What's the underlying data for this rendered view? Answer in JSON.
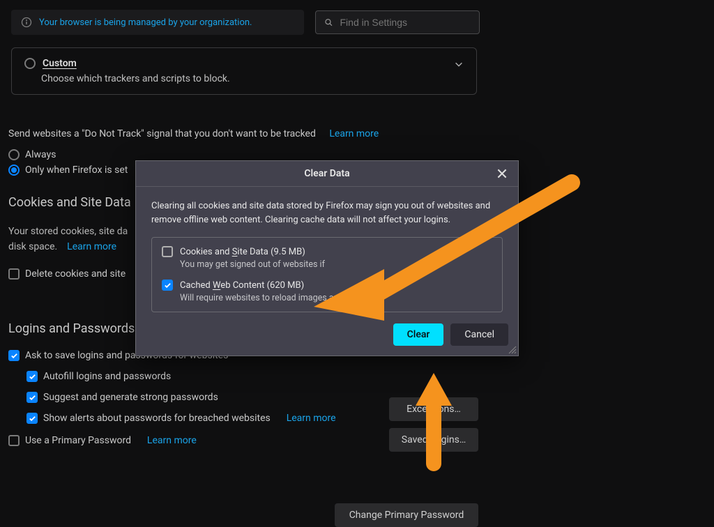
{
  "topbar": {
    "notice": "Your browser is being managed by your organization.",
    "search_placeholder": "Find in Settings"
  },
  "custom_section": {
    "title": "Custom",
    "desc": "Choose which trackers and scripts to block."
  },
  "dnt": {
    "text_pre": "Send websites a \"Do Not Track\" signal that you don't want to be tracked",
    "learn_more": "Learn more",
    "opt_always": "Always",
    "opt_only": "Only when Firefox is set"
  },
  "cookies": {
    "heading": "Cookies and Site Data",
    "desc_a": "Your stored cookies, site da",
    "desc_b": "disk space.",
    "learn_more": "Learn more",
    "delete_label": "Delete cookies and site "
  },
  "logins": {
    "heading": "Logins and Passwords",
    "ask": "Ask to save logins and passwords for websites",
    "autofill": "Autofill logins and passwords",
    "suggest": "Suggest and generate strong passwords",
    "alerts": "Show alerts about passwords for breached websites",
    "alerts_learn": "Learn more",
    "primary": "Use a Primary Password",
    "primary_learn": "Learn more"
  },
  "side_buttons": {
    "exceptions": "Exceptions…",
    "saved_logins": "Saved Logins…",
    "change_pw": "Change Primary Password"
  },
  "dialog": {
    "title": "Clear Data",
    "paragraph": "Clearing all cookies and site data stored by Firefox may sign you out of websites and remove offline web content. Clearing cache data will not affect your logins.",
    "opt1_label_a": "Cookies and ",
    "opt1_label_b": "S",
    "opt1_label_c": "ite Data (9.5 MB)",
    "opt1_sub": "You may get signed out of websites if",
    "opt2_label_a": "Cached ",
    "opt2_label_b": "W",
    "opt2_label_c": "eb Content (620 MB)",
    "opt2_sub": "Will require websites to reload images and data",
    "clear": "Clear",
    "cancel": "Cancel"
  }
}
